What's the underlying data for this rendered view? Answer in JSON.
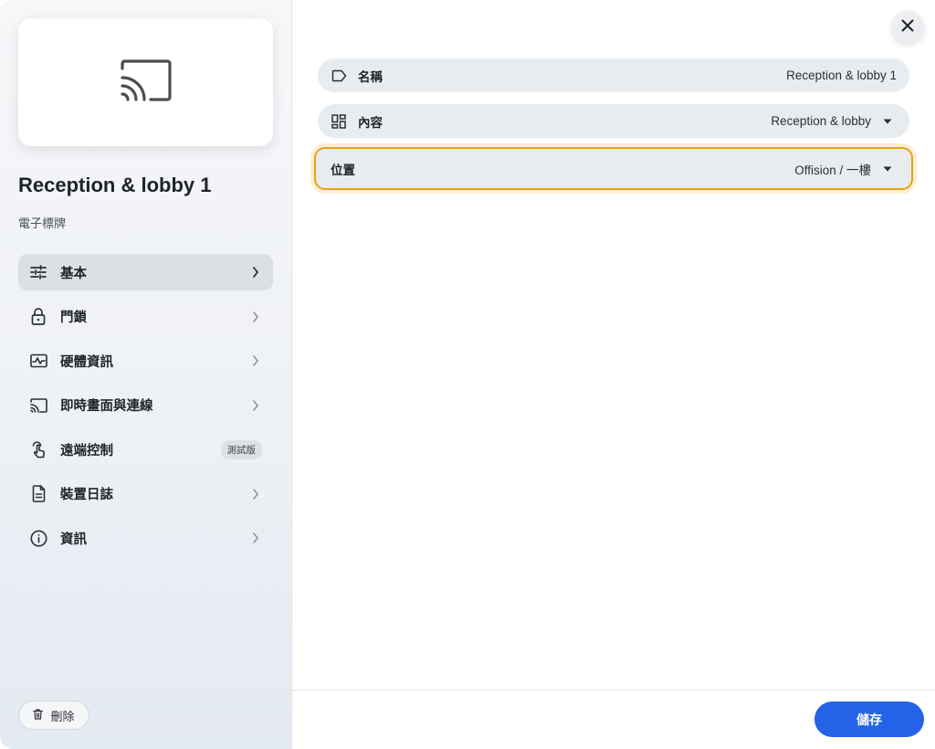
{
  "sidebar": {
    "device_name": "Reception & lobby 1",
    "device_type": "電子標牌",
    "items": [
      {
        "label": "基本",
        "icon": "sliders-icon",
        "active": true
      },
      {
        "label": "門鎖",
        "icon": "lock-icon"
      },
      {
        "label": "硬體資訊",
        "icon": "hardware-monitor-icon"
      },
      {
        "label": "即時畫面與連線",
        "icon": "cast-icon"
      },
      {
        "label": "遠端控制",
        "icon": "touch-hand-icon",
        "badge": "測試版"
      },
      {
        "label": "裝置日誌",
        "icon": "document-icon"
      },
      {
        "label": "資訊",
        "icon": "info-icon"
      }
    ],
    "delete_label": "刪除"
  },
  "form": {
    "name": {
      "label": "名稱",
      "value": "Reception & lobby 1",
      "icon": "tag-icon"
    },
    "content": {
      "label": "內容",
      "value": "Reception & lobby",
      "icon": "layout-icon"
    },
    "location": {
      "label": "位置",
      "value": "Offision / 一樓"
    }
  },
  "footer": {
    "save_label": "儲存"
  },
  "colors": {
    "accent": "#2463e8",
    "focus_outline": "#e8a21a"
  }
}
